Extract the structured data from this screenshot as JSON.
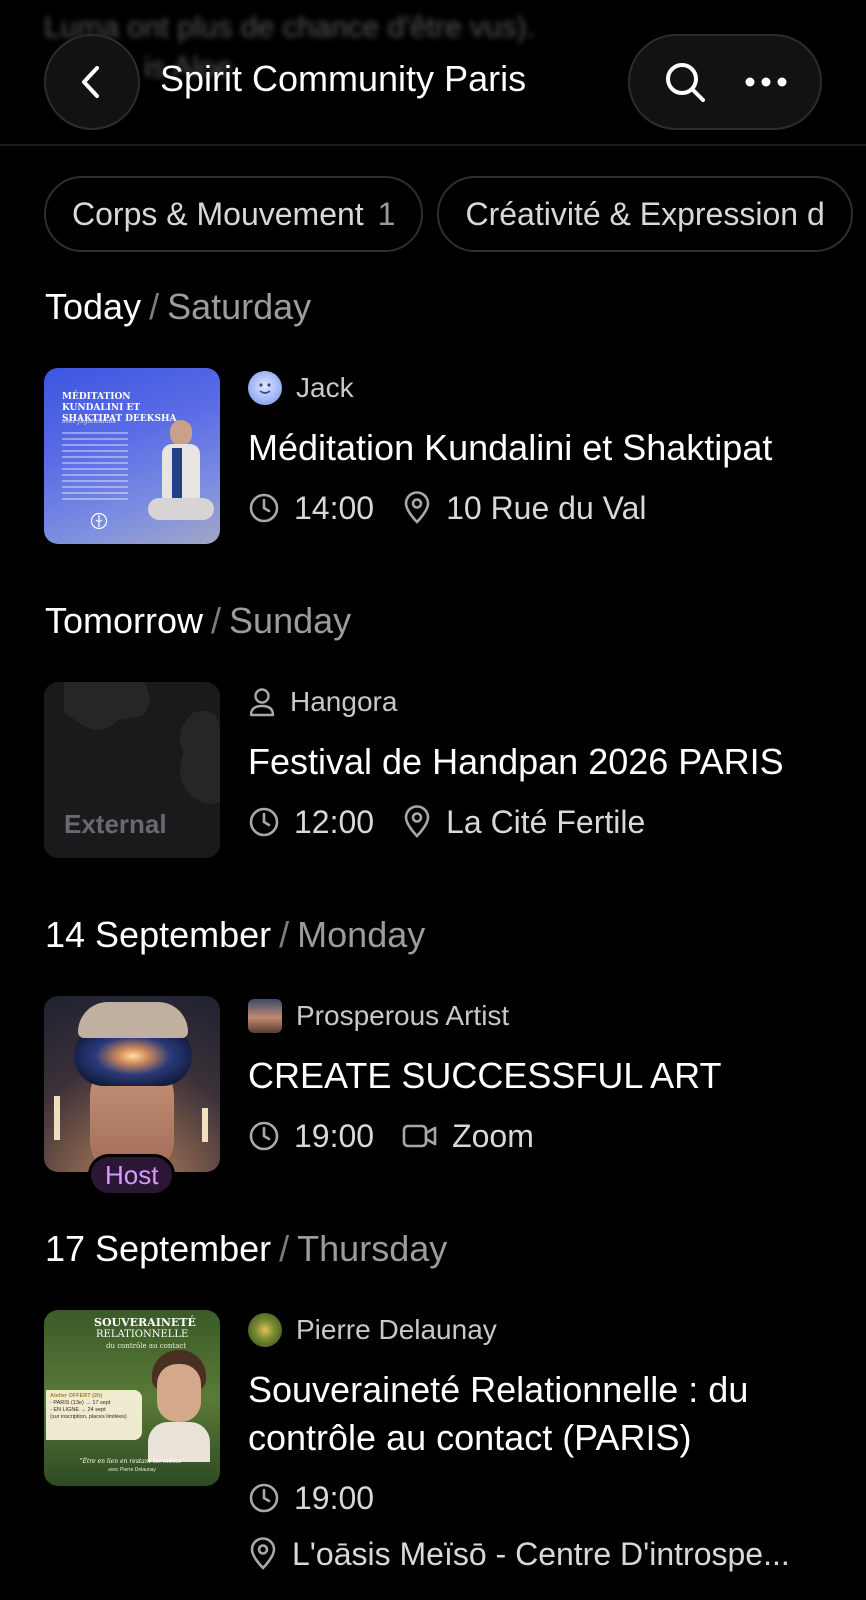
{
  "background_text": {
    "line1": "Luma ont plus de chance d'être vus).",
    "line2": "is Aloe"
  },
  "header": {
    "title": "Spirit Community Paris",
    "back_icon": "chevron-left-icon",
    "search_icon": "search-icon",
    "more_icon": "more-horizontal-icon"
  },
  "chips": [
    {
      "label": "Corps & Mouvement",
      "count": "1"
    },
    {
      "label": "Créativité & Expression d",
      "count": ""
    }
  ],
  "sections": [
    {
      "date": "Today",
      "day": "Saturday",
      "event": {
        "host": "Jack",
        "title": "Méditation Kundalini et Shaktipat",
        "time": "14:00",
        "location": "10 Rue du Val",
        "location_icon": "map-pin-icon",
        "poster_text": {
          "heading": "MÉDITATION KUNDALINI ET SHAKTIPAT DEEKSHA",
          "subtitle": "avec Jagatananda"
        }
      }
    },
    {
      "date": "Tomorrow",
      "day": "Sunday",
      "event": {
        "host": "Hangora",
        "title": "Festival de Handpan 2026 PARIS",
        "time": "12:00",
        "location": "La Cité Fertile",
        "location_icon": "map-pin-icon",
        "thumb_label": "External"
      }
    },
    {
      "date": "14 September",
      "day": "Monday",
      "event": {
        "host": "Prosperous Artist",
        "title": "CREATE SUCCESSFUL ART",
        "time": "19:00",
        "location": "Zoom",
        "location_icon": "video-icon",
        "badge": "Host"
      }
    },
    {
      "date": "17 September",
      "day": "Thursday",
      "event": {
        "host": "Pierre Delaunay",
        "title": "Souveraineté Relationnelle : du contrôle au contact (PARIS)",
        "time": "19:00",
        "location": "L'oāsis Meïsō - Centre D'introspe...",
        "location_icon": "map-pin-icon",
        "poster_text": {
          "heading1": "SOUVERAINETÉ",
          "heading2": "RELATIONNELLE",
          "heading3": "du contrôle au contact",
          "box1": "Atelier OFFERT (2h)",
          "box2": "- PARIS (13e) → 17 sept",
          "box3": "- EN LIGNE → 24 sept",
          "box4": "(sur inscription, places limitées)",
          "quote": "\"Être en lien en restant toi-même\"",
          "author": "avec Pierre Delaunay"
        }
      }
    }
  ],
  "colors": {
    "background": "#000000",
    "chip_border": "#2e2e30",
    "muted_text": "#9c9ca0",
    "host_badge_bg": "#2b1636",
    "host_badge_text": "#d69bff"
  }
}
